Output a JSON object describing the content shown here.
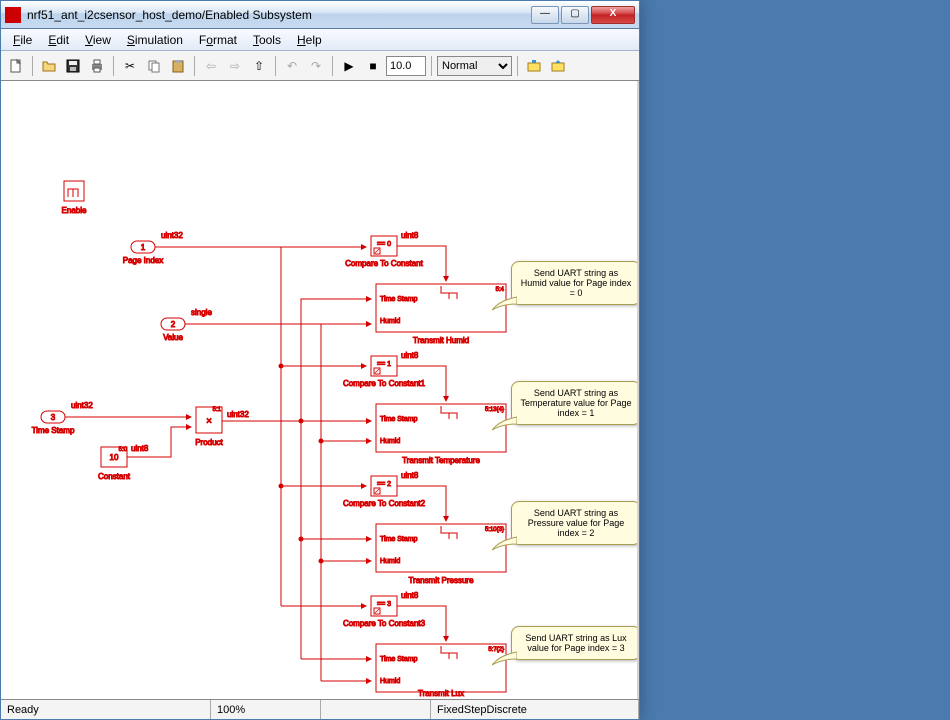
{
  "window": {
    "title": "nrf51_ant_i2csensor_host_demo/Enabled Subsystem"
  },
  "menu": {
    "file": "File",
    "edit": "Edit",
    "view": "View",
    "simulation": "Simulation",
    "format": "Format",
    "tools": "Tools",
    "help": "Help"
  },
  "toolbar": {
    "simtime": "10.0",
    "mode": "Normal"
  },
  "statusbar": {
    "ready": "Ready",
    "zoom": "100%",
    "solver": "FixedStepDiscrete"
  },
  "diagram": {
    "enable_block": "Enable",
    "inport1": {
      "num": "1",
      "label": "Page Index",
      "dtype": "uint32"
    },
    "inport2": {
      "num": "2",
      "label": "Value",
      "dtype": "single"
    },
    "inport3": {
      "num": "3",
      "label": "Time Stamp",
      "dtype": "uint32"
    },
    "constant": {
      "val": "10",
      "label": "Constant",
      "dtype": "uint8",
      "tag": "5:0"
    },
    "product": {
      "label": "Product",
      "dtype_out": "uint32",
      "tag": "5:1"
    },
    "compare0": {
      "op": "== 0",
      "label": "Compare To Constant",
      "dtype": "uint8"
    },
    "compare1": {
      "op": "== 1",
      "label": "Compare To Constant1",
      "dtype": "uint8"
    },
    "compare2": {
      "op": "== 2",
      "label": "Compare To Constant2",
      "dtype": "uint8"
    },
    "compare3": {
      "op": "== 3",
      "label": "Compare To Constant3",
      "dtype": "uint8"
    },
    "xmit0": {
      "label": "Transmit Humid",
      "in1": "Time Stamp",
      "in2": "Humid",
      "tag": "5:4"
    },
    "xmit1": {
      "label": "Transmit Temperature",
      "in1": "Time Stamp",
      "in2": "Humid",
      "tag": "5:13{4}"
    },
    "xmit2": {
      "label": "Transmit Pressure",
      "in1": "Time Stamp",
      "in2": "Humid",
      "tag": "5:10{3}"
    },
    "xmit3": {
      "label": "Transmit Lux",
      "in1": "Time Stamp",
      "in2": "Humid",
      "tag": "5:7{2}"
    },
    "callout0": "Send UART string as Humid value for Page index = 0",
    "callout1": "Send UART string as Temperature value for Page index = 1",
    "callout2": "Send UART string as Pressure value for Page index = 2",
    "callout3": "Send UART string as Lux value for Page index = 3"
  },
  "icons": {
    "new": "new-file-icon",
    "open": "open-folder-icon",
    "save": "save-icon",
    "print": "print-icon",
    "cut": "cut-icon",
    "copy": "copy-icon",
    "paste": "paste-icon",
    "back": "nav-back-icon",
    "fwd": "nav-fwd-icon",
    "up": "nav-up-icon",
    "undo": "undo-icon",
    "redo": "redo-icon",
    "play": "play-icon",
    "stop": "stop-icon",
    "build": "build-icon",
    "build2": "build-incremental-icon"
  }
}
